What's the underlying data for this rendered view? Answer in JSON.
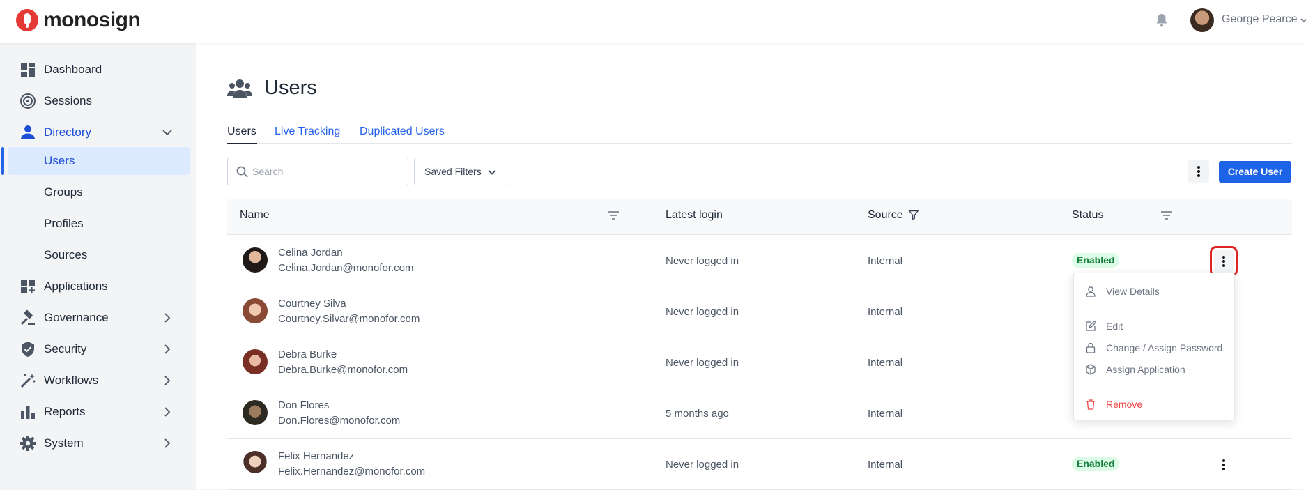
{
  "brand": {
    "name": "monosign",
    "accent": "#e53935"
  },
  "header": {
    "user_name": "George Pearce"
  },
  "sidebar": {
    "items": [
      {
        "label": "Dashboard",
        "icon": "dashboard-icon"
      },
      {
        "label": "Sessions",
        "icon": "sessions-icon"
      },
      {
        "label": "Directory",
        "icon": "directory-icon"
      },
      {
        "label": "Applications",
        "icon": "applications-icon"
      },
      {
        "label": "Governance",
        "icon": "governance-icon"
      },
      {
        "label": "Security",
        "icon": "shield-icon"
      },
      {
        "label": "Workflows",
        "icon": "workflows-icon"
      },
      {
        "label": "Reports",
        "icon": "reports-icon"
      },
      {
        "label": "System",
        "icon": "gear-icon"
      }
    ],
    "directory_sub": [
      {
        "label": "Users"
      },
      {
        "label": "Groups"
      },
      {
        "label": "Profiles"
      },
      {
        "label": "Sources"
      }
    ]
  },
  "page": {
    "title": "Users",
    "tabs": [
      {
        "label": "Users"
      },
      {
        "label": "Live Tracking"
      },
      {
        "label": "Duplicated Users"
      }
    ]
  },
  "toolbar": {
    "search_placeholder": "Search",
    "saved_filters": "Saved Filters",
    "create_user": "Create User"
  },
  "table": {
    "columns": [
      "Name",
      "Latest login",
      "Source",
      "Status"
    ],
    "rows": [
      {
        "name": "Celina Jordan",
        "email": "Celina.Jordan@monofor.com",
        "login": "Never logged in",
        "source": "Internal",
        "status": "Enabled"
      },
      {
        "name": "Courtney Silva",
        "email": "Courtney.Silvar@monofor.com",
        "login": "Never logged in",
        "source": "Internal",
        "status": ""
      },
      {
        "name": "Debra Burke",
        "email": "Debra.Burke@monofor.com",
        "login": "Never logged in",
        "source": "Internal",
        "status": ""
      },
      {
        "name": "Don Flores",
        "email": "Don.Flores@monofor.com",
        "login": "5 months ago",
        "source": "Internal",
        "status": ""
      },
      {
        "name": "Felix Hernandez",
        "email": "Felix.Hernandez@monofor.com",
        "login": "Never logged in",
        "source": "Internal",
        "status": "Enabled"
      }
    ]
  },
  "row_menu": {
    "view_details": "View Details",
    "edit": "Edit",
    "change_password": "Change / Assign Password",
    "assign_application": "Assign Application",
    "remove": "Remove"
  }
}
